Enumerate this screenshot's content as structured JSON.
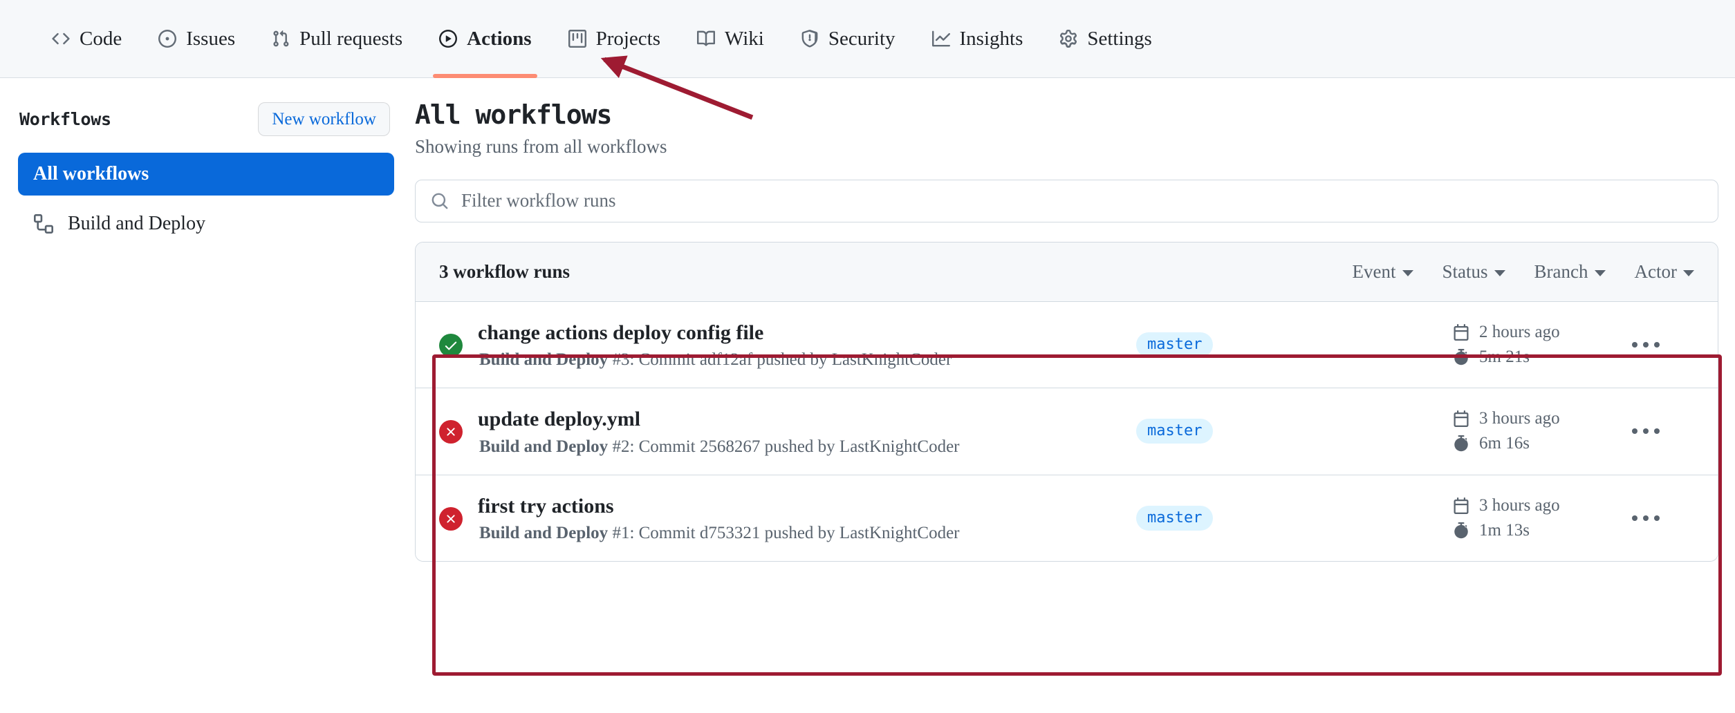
{
  "repo_nav": {
    "tabs": [
      {
        "label": "Code",
        "icon": "code-icon",
        "active": false
      },
      {
        "label": "Issues",
        "icon": "issue-opened-icon",
        "active": false
      },
      {
        "label": "Pull requests",
        "icon": "git-pull-request-icon",
        "active": false
      },
      {
        "label": "Actions",
        "icon": "play-icon",
        "active": true
      },
      {
        "label": "Projects",
        "icon": "project-board-icon",
        "active": false
      },
      {
        "label": "Wiki",
        "icon": "book-icon",
        "active": false
      },
      {
        "label": "Security",
        "icon": "shield-icon",
        "active": false
      },
      {
        "label": "Insights",
        "icon": "graph-icon",
        "active": false
      },
      {
        "label": "Settings",
        "icon": "gear-icon",
        "active": false
      }
    ]
  },
  "sidebar": {
    "title": "Workflows",
    "new_workflow_label": "New workflow",
    "items": [
      {
        "label": "All workflows",
        "icon": null,
        "selected": true
      },
      {
        "label": "Build and Deploy",
        "icon": "workflow-icon",
        "selected": false
      }
    ]
  },
  "main": {
    "title": "All workflows",
    "subtitle": "Showing runs from all workflows",
    "filter_placeholder": "Filter workflow runs",
    "filter_value": "",
    "runs_count_label": "3 workflow runs",
    "filters": [
      {
        "label": "Event"
      },
      {
        "label": "Status"
      },
      {
        "label": "Branch"
      },
      {
        "label": "Actor"
      }
    ],
    "runs": [
      {
        "status": "success",
        "status_icon": "check-circle-icon",
        "title": "change actions deploy config file",
        "workflow_name": "Build and Deploy",
        "detail": " #3: Commit adf12af pushed by LastKnightCoder",
        "branch": "master",
        "time_ago": "2 hours ago",
        "duration": "5m 21s",
        "calendar_icon": "calendar-icon",
        "stopwatch_icon": "stopwatch-icon",
        "menu_icon": "kebab-horizontal-icon"
      },
      {
        "status": "failure",
        "status_icon": "x-circle-icon",
        "title": "update deploy.yml",
        "workflow_name": "Build and Deploy",
        "detail": " #2: Commit 2568267 pushed by LastKnightCoder",
        "branch": "master",
        "time_ago": "3 hours ago",
        "duration": "6m 16s",
        "calendar_icon": "calendar-icon",
        "stopwatch_icon": "stopwatch-icon",
        "menu_icon": "kebab-horizontal-icon"
      },
      {
        "status": "failure",
        "status_icon": "x-circle-icon",
        "title": "first try actions",
        "workflow_name": "Build and Deploy",
        "detail": " #1: Commit d753321 pushed by LastKnightCoder",
        "branch": "master",
        "time_ago": "3 hours ago",
        "duration": "1m 13s",
        "calendar_icon": "calendar-icon",
        "stopwatch_icon": "stopwatch-icon",
        "menu_icon": "kebab-horizontal-icon"
      }
    ]
  },
  "annotations": {
    "highlight_color": "#9e1b32",
    "arrow_color": "#9e1b32",
    "active_tab_underline_color": "#fd8c73",
    "arrow_target": "Actions",
    "highlight_target": "workflow-runs-list"
  },
  "colors": {
    "accent_blue": "#0969da",
    "success_green": "#1f883d",
    "failure_red": "#cf222e",
    "branch_badge_bg": "#ddf4ff",
    "header_bg": "#f6f8fa",
    "border": "#d1d9e0",
    "muted_text": "#59636e"
  }
}
